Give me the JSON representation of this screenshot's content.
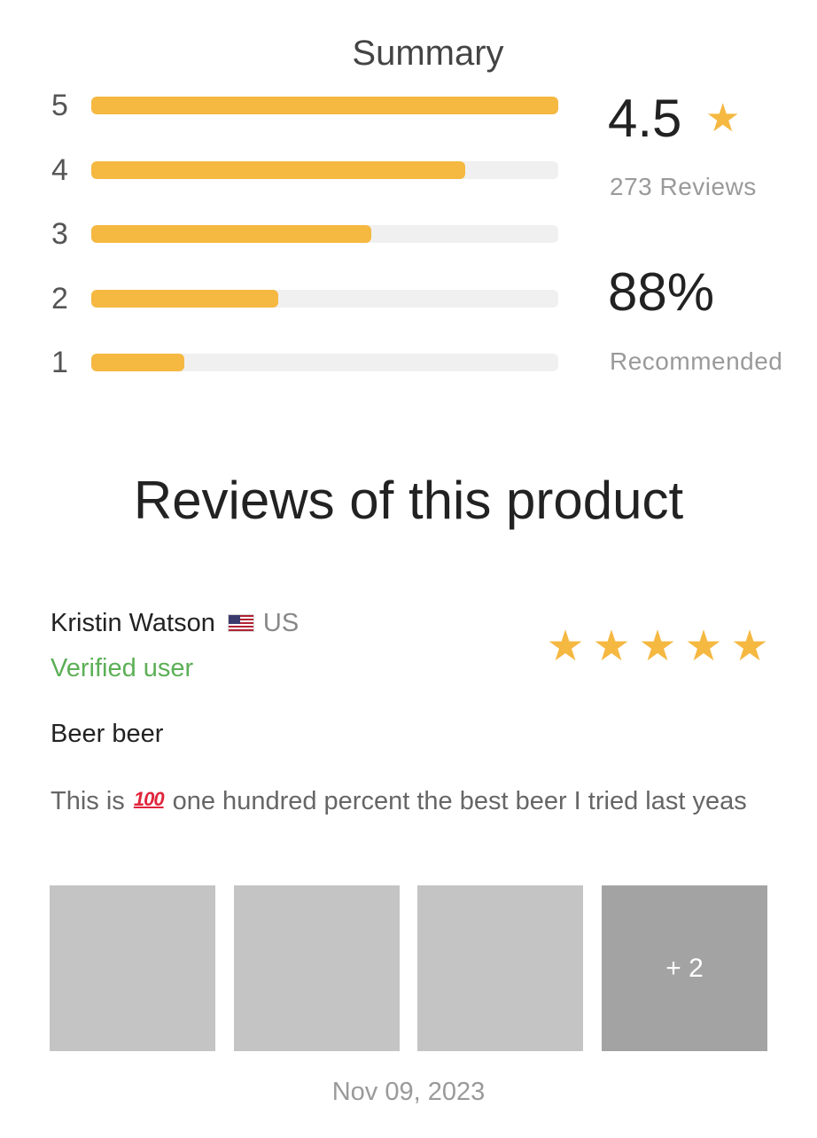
{
  "summary": {
    "title": "Summary",
    "breakdown": [
      {
        "stars": "5",
        "fraction": 1.0
      },
      {
        "stars": "4",
        "fraction": 0.8
      },
      {
        "stars": "3",
        "fraction": 0.6
      },
      {
        "stars": "2",
        "fraction": 0.4
      },
      {
        "stars": "1",
        "fraction": 0.2
      }
    ],
    "average": "4.5",
    "average_star": "★",
    "review_count": "273 Reviews",
    "recommended_percent": "88%",
    "recommended_label": "Recommended"
  },
  "reviews": {
    "heading": "Reviews of this product",
    "items": [
      {
        "name": "Kristin Watson",
        "flag_icon": "us-flag-icon",
        "country": "US",
        "verified": "Verified user",
        "rating": 5,
        "star_glyph": "★",
        "title": "Beer beer",
        "body_before": "This is ",
        "body_emoji": "100",
        "body_after": " one hundred percent the best beer I tried last yeas",
        "extra_photos": "+ 2",
        "date": "Nov 09, 2023"
      }
    ]
  },
  "colors": {
    "accent": "#f5b841",
    "track": "#f0f0f0",
    "verified": "#5caf56",
    "muted_text": "#9a9a9a",
    "thumb": "#c4c4c4",
    "thumb_more": "#a3a3a3"
  }
}
